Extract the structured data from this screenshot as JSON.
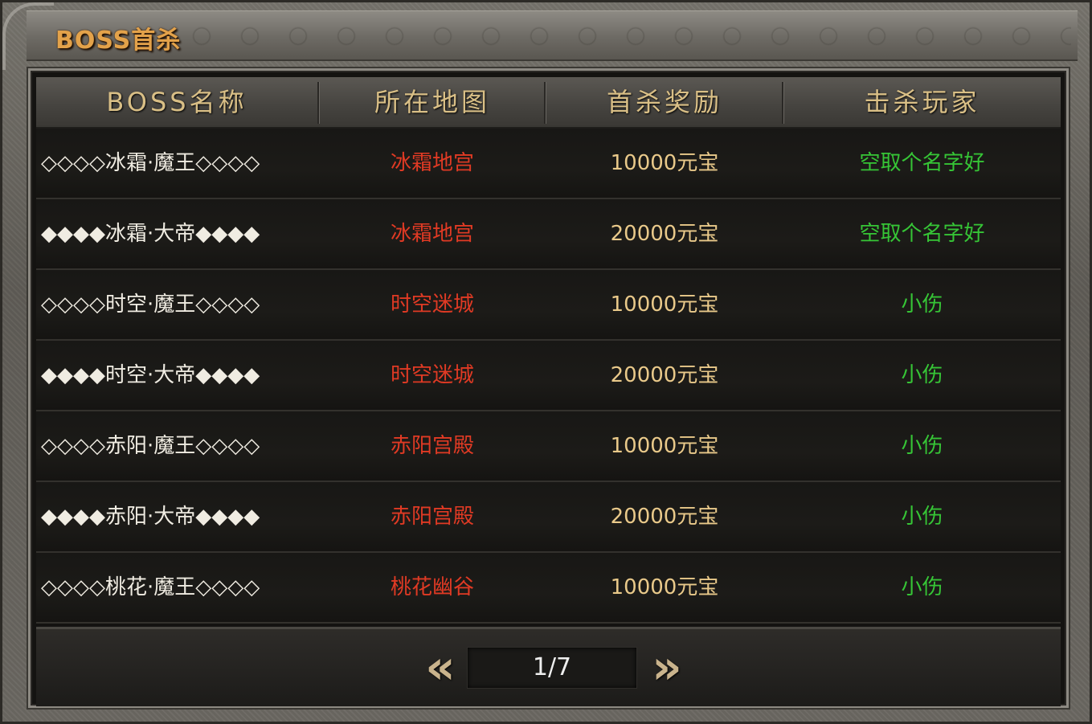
{
  "window": {
    "title": "BOSS首杀"
  },
  "table": {
    "headers": [
      "BOSS名称",
      "所在地图",
      "首杀奖励",
      "击杀玩家"
    ],
    "rows": [
      {
        "boss": "◇◇◇◇冰霜·魔王◇◇◇◇",
        "map": "冰霜地宫",
        "reward": "10000元宝",
        "killer": "空取个名字好"
      },
      {
        "boss": "◆◆◆◆冰霜·大帝◆◆◆◆",
        "map": "冰霜地宫",
        "reward": "20000元宝",
        "killer": "空取个名字好"
      },
      {
        "boss": "◇◇◇◇时空·魔王◇◇◇◇",
        "map": "时空迷城",
        "reward": "10000元宝",
        "killer": "小伤"
      },
      {
        "boss": "◆◆◆◆时空·大帝◆◆◆◆",
        "map": "时空迷城",
        "reward": "20000元宝",
        "killer": "小伤"
      },
      {
        "boss": "◇◇◇◇赤阳·魔王◇◇◇◇",
        "map": "赤阳宫殿",
        "reward": "10000元宝",
        "killer": "小伤"
      },
      {
        "boss": "◆◆◆◆赤阳·大帝◆◆◆◆",
        "map": "赤阳宫殿",
        "reward": "20000元宝",
        "killer": "小伤"
      },
      {
        "boss": "◇◇◇◇桃花·魔王◇◇◇◇",
        "map": "桃花幽谷",
        "reward": "10000元宝",
        "killer": "小伤"
      }
    ]
  },
  "pager": {
    "prev": "«",
    "label": "1/7",
    "next": "»"
  },
  "colors": {
    "title": "#e3a24a",
    "map": "#e03a24",
    "reward": "#e9c98a",
    "killer": "#36c536",
    "header": "#d9bf86"
  }
}
